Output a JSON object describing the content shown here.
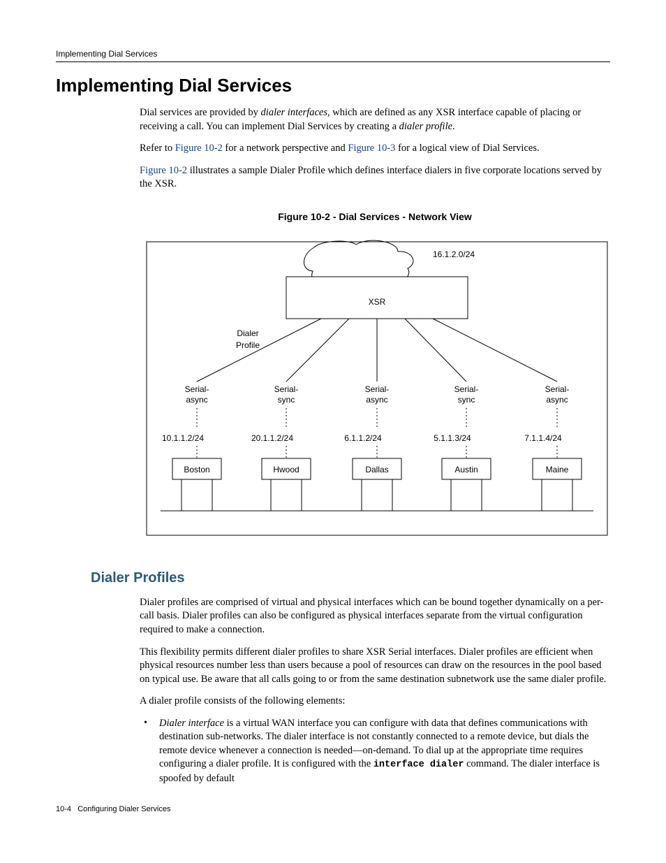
{
  "running_head": "Implementing Dial Services",
  "h1": "Implementing Dial Services",
  "intro": {
    "p1_a": "Dial services are provided by ",
    "p1_i": "dialer interfaces",
    "p1_b": ", which are defined as any XSR interface capable of placing or receiving a call. You can implement Dial Services by creating a ",
    "p1_c": "dialer profile",
    "p1_d": ".",
    "p2_a": "Refer to ",
    "p2_l1": "Figure 10-2",
    "p2_b": " for a network perspective and ",
    "p2_l2": "Figure 10-3",
    "p2_c": " for a logical view of Dial Services.",
    "p3_a": "Figure 10-2",
    "p3_b": " illustrates a sample Dialer Profile which defines interface dialers in five corporate locations served by the XSR."
  },
  "figure": {
    "title": "Figure 10-2    - Dial Services - Network View",
    "wan": "16.1.2.0/24",
    "device": "XSR",
    "profile_a": "Dialer",
    "profile_b": "Profile",
    "cols": [
      {
        "type_a": "Serial-",
        "type_b": "async",
        "ip": "10.1.1.2/24",
        "site": "Boston"
      },
      {
        "type_a": "Serial-",
        "type_b": "sync",
        "ip": "20.1.1.2/24",
        "site": "Hwood"
      },
      {
        "type_a": "Serial-",
        "type_b": "async",
        "ip": "6.1.1.2/24",
        "site": "Dallas"
      },
      {
        "type_a": "Serial-",
        "type_b": "sync",
        "ip": "5.1.1.3/24",
        "site": "Austin"
      },
      {
        "type_a": "Serial-",
        "type_b": "async",
        "ip": "7.1.1.4/24",
        "site": "Maine"
      }
    ]
  },
  "h2": "Dialer Profiles",
  "dp": {
    "p1": "Dialer profiles are comprised of virtual and physical interfaces which can be bound together dynamically on a per-call basis. Dialer profiles can also be configured as physical interfaces separate from the virtual configuration required to make a connection.",
    "p2": "This flexibility permits different dialer profiles to share XSR Serial interfaces. Dialer profiles are efficient when physical resources number less than users because a pool of resources can draw on the resources in the pool based on typical use. Be aware that all calls going to or from the same destination subnetwork use the same dialer profile.",
    "p3": "A dialer profile consists of the following elements:",
    "li1_a": "Dialer interface",
    "li1_b": " is a virtual WAN interface you can configure with data that defines communications with destination sub-networks. The dialer interface is not constantly connected to a remote device, but dials the remote device whenever a connection is needed—on-demand. To dial up at the appropriate time requires configuring a dialer profile. It is configured with the ",
    "li1_cmd": "interface dialer",
    "li1_c": " command. The dialer interface is spoofed by default"
  },
  "footer_a": "10-4",
  "footer_b": "Configuring Dialer Services"
}
